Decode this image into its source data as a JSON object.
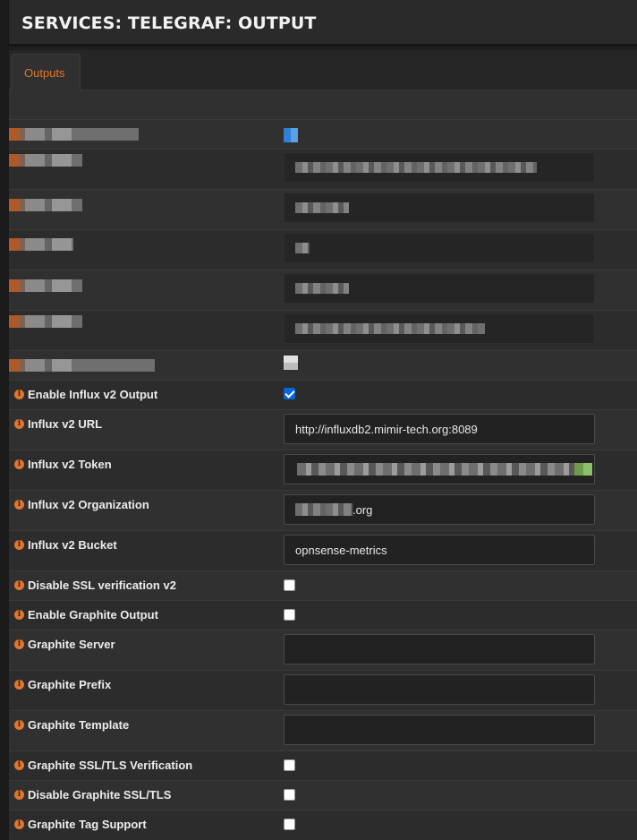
{
  "page": {
    "title": "SERVICES: TELEGRAF: OUTPUT"
  },
  "tabs": [
    {
      "label": "Outputs",
      "active": true
    }
  ],
  "colors": {
    "accent": "#e2762c",
    "checkbox_checked": "#0a66d8",
    "background": "#2c2c2c"
  },
  "fields": {
    "enable_influx_v2": {
      "label": "Enable Influx v2 Output",
      "checked": true
    },
    "influx_v2_url": {
      "label": "Influx v2 URL",
      "value": "http://influxdb2.mimir-tech.org:8089"
    },
    "influx_v2_token": {
      "label": "Influx v2 Token",
      "value": ""
    },
    "influx_v2_org": {
      "label": "Influx v2 Organization",
      "value_suffix": ".org"
    },
    "influx_v2_bucket": {
      "label": "Influx v2 Bucket",
      "value": "opnsense-metrics"
    },
    "disable_ssl_v2": {
      "label": "Disable SSL verification v2",
      "checked": false
    },
    "enable_graphite": {
      "label": "Enable Graphite Output",
      "checked": false
    },
    "graphite_server": {
      "label": "Graphite Server",
      "value": ""
    },
    "graphite_prefix": {
      "label": "Graphite Prefix",
      "value": ""
    },
    "graphite_template": {
      "label": "Graphite Template",
      "value": ""
    },
    "graphite_ssl_verification": {
      "label": "Graphite SSL/TLS Verification",
      "checked": false
    },
    "disable_graphite_ssl": {
      "label": "Disable Graphite SSL/TLS",
      "checked": false
    },
    "graphite_tag_support": {
      "label": "Graphite Tag Support",
      "checked": false
    }
  },
  "icons": {
    "info": "info-circle-icon"
  }
}
